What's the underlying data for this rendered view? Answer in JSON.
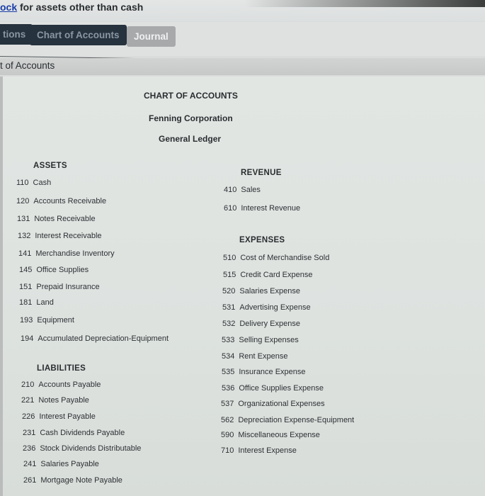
{
  "instruction": {
    "link_fragment": "ock",
    "text": " for assets other than cash"
  },
  "tabs": [
    {
      "label": "tions",
      "active": false
    },
    {
      "label": "Chart of Accounts",
      "active": false
    },
    {
      "label": "Journal",
      "active": true
    }
  ],
  "section_title": "t of Accounts",
  "chart": {
    "title": "CHART OF ACCOUNTS",
    "company": "Fenning Corporation",
    "ledger": "General Ledger"
  },
  "assets": {
    "title": "ASSETS",
    "accounts": [
      {
        "num": "110",
        "name": "Cash"
      },
      {
        "num": "120",
        "name": "Accounts Receivable"
      },
      {
        "num": "131",
        "name": "Notes Receivable"
      },
      {
        "num": "132",
        "name": "Interest Receivable"
      },
      {
        "num": "141",
        "name": "Merchandise Inventory"
      },
      {
        "num": "145",
        "name": "Office Supplies"
      },
      {
        "num": "151",
        "name": "Prepaid Insurance"
      },
      {
        "num": "181",
        "name": "Land"
      },
      {
        "num": "193",
        "name": "Equipment"
      },
      {
        "num": "194",
        "name": "Accumulated Depreciation-Equipment"
      }
    ]
  },
  "liabilities": {
    "title": "LIABILITIES",
    "accounts": [
      {
        "num": "210",
        "name": "Accounts Payable"
      },
      {
        "num": "221",
        "name": "Notes Payable"
      },
      {
        "num": "226",
        "name": "Interest Payable"
      },
      {
        "num": "231",
        "name": "Cash Dividends Payable"
      },
      {
        "num": "236",
        "name": "Stock Dividends Distributable"
      },
      {
        "num": "241",
        "name": "Salaries Payable"
      },
      {
        "num": "261",
        "name": "Mortgage Note Payable"
      }
    ]
  },
  "revenue": {
    "title": "REVENUE",
    "accounts": [
      {
        "num": "410",
        "name": "Sales"
      },
      {
        "num": "610",
        "name": "Interest Revenue"
      }
    ]
  },
  "expenses": {
    "title": "EXPENSES",
    "accounts": [
      {
        "num": "510",
        "name": "Cost of Merchandise Sold"
      },
      {
        "num": "515",
        "name": "Credit Card Expense"
      },
      {
        "num": "520",
        "name": "Salaries Expense"
      },
      {
        "num": "531",
        "name": "Advertising Expense"
      },
      {
        "num": "532",
        "name": "Delivery Expense"
      },
      {
        "num": "533",
        "name": "Selling Expenses"
      },
      {
        "num": "534",
        "name": "Rent Expense"
      },
      {
        "num": "535",
        "name": "Insurance Expense"
      },
      {
        "num": "536",
        "name": "Office Supplies Expense"
      },
      {
        "num": "537",
        "name": "Organizational Expenses"
      },
      {
        "num": "562",
        "name": "Depreciation Expense-Equipment"
      },
      {
        "num": "590",
        "name": "Miscellaneous Expense"
      },
      {
        "num": "710",
        "name": "Interest Expense"
      }
    ]
  }
}
